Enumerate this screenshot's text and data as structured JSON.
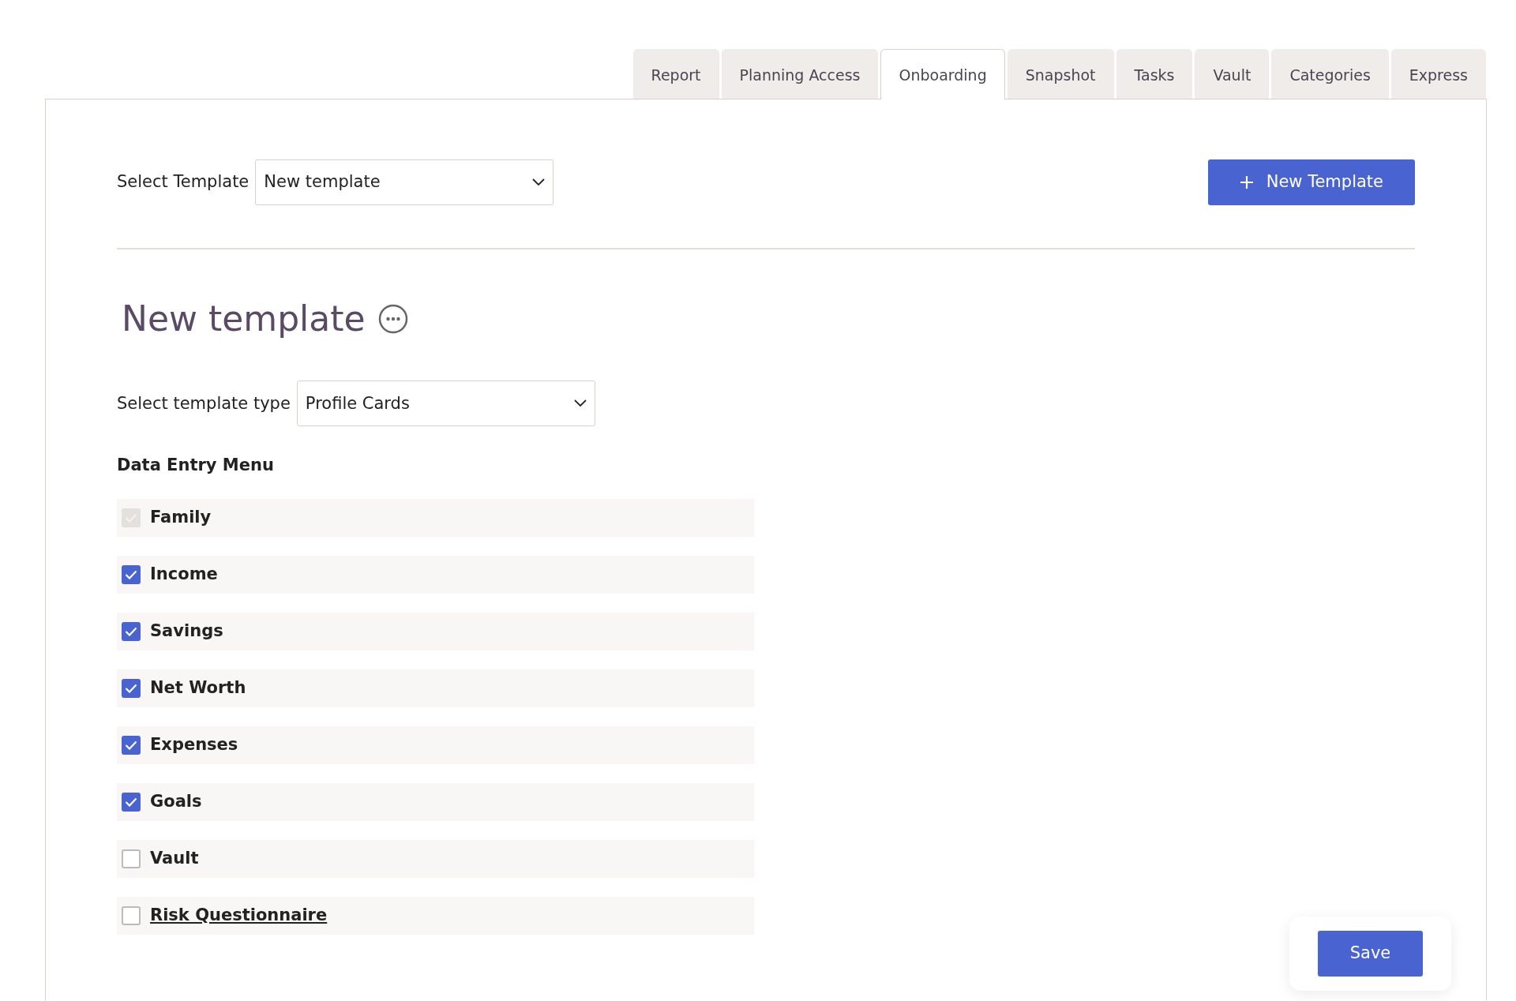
{
  "tabs": [
    {
      "label": "Report",
      "selected": false
    },
    {
      "label": "Planning Access",
      "selected": false
    },
    {
      "label": "Onboarding",
      "selected": true
    },
    {
      "label": "Snapshot",
      "selected": false
    },
    {
      "label": "Tasks",
      "selected": false
    },
    {
      "label": "Vault",
      "selected": false
    },
    {
      "label": "Categories",
      "selected": false
    },
    {
      "label": "Express",
      "selected": false
    }
  ],
  "template_select": {
    "label": "Select Template",
    "value": "New template"
  },
  "new_template_button": {
    "label": "New Template"
  },
  "title": "New template",
  "template_type_select": {
    "label": "Select template type",
    "value": "Profile Cards"
  },
  "menu_heading": "Data Entry Menu",
  "menu_items": [
    {
      "label": "Family",
      "checked": true,
      "disabled": true,
      "kind": "plain"
    },
    {
      "label": "Income",
      "checked": true,
      "disabled": false,
      "kind": "plain"
    },
    {
      "label": "Savings",
      "checked": true,
      "disabled": false,
      "kind": "plain"
    },
    {
      "label": "Net Worth",
      "checked": true,
      "disabled": false,
      "kind": "plain"
    },
    {
      "label": "Expenses",
      "checked": true,
      "disabled": false,
      "kind": "plain"
    },
    {
      "label": "Goals",
      "checked": true,
      "disabled": false,
      "kind": "plain"
    },
    {
      "label": "Vault",
      "checked": false,
      "disabled": false,
      "kind": "plain"
    },
    {
      "label": "Risk Questionnaire",
      "checked": false,
      "disabled": false,
      "kind": "link"
    }
  ],
  "save_button": {
    "label": "Save"
  }
}
